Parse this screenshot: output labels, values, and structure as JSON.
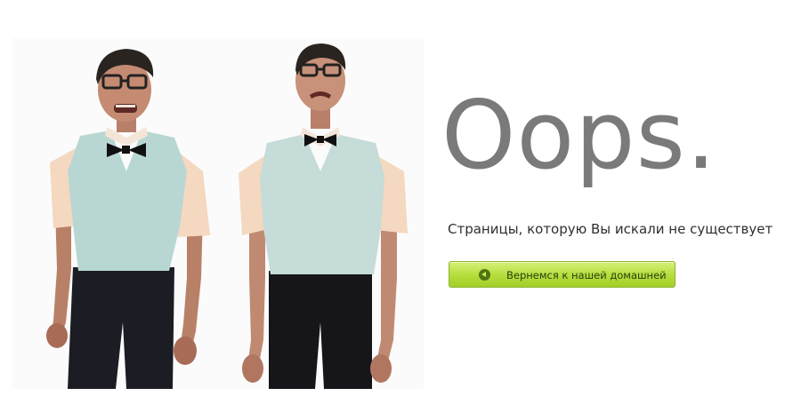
{
  "heading": "Oops.",
  "message": "Страницы, которую Вы искали не существует",
  "home_button": {
    "label": "Вернемся к нашей домашней",
    "icon": "arrow-left-circle-icon"
  },
  "illustration": {
    "description_icon": "two-nerds-photo"
  },
  "colors": {
    "heading": "#7a7a7a",
    "button_green": "#b4dd3a",
    "button_icon": "#4e7410"
  }
}
